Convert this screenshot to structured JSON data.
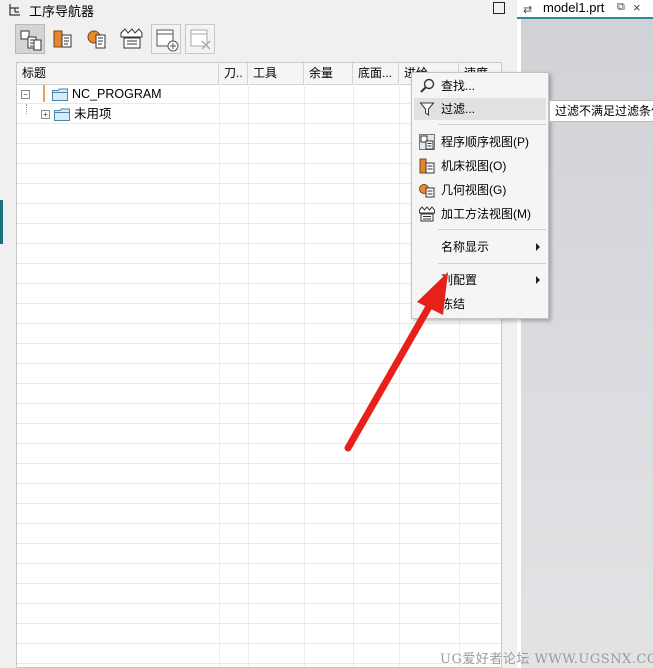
{
  "navigator": {
    "title": "工序导航器",
    "toolbar": [
      {
        "name": "program-order-view",
        "icon": "program-order-icon",
        "state": "active"
      },
      {
        "name": "machine-tool-view",
        "icon": "machine-tool-icon"
      },
      {
        "name": "geometry-view",
        "icon": "geometry-icon"
      },
      {
        "name": "machining-method-view",
        "icon": "machining-method-icon"
      },
      {
        "name": "add-column",
        "icon": "add-column-icon"
      },
      {
        "name": "remove-column",
        "icon": "remove-column-icon",
        "state": "disabled"
      }
    ],
    "columns": [
      "标题",
      "刀..",
      "工具",
      "余量",
      "底面...",
      "进给",
      "速度"
    ],
    "rows": [
      {
        "label": "NC_PROGRAM",
        "expander": "−",
        "icon": "folder-icon"
      },
      {
        "label": "未用项",
        "expander": "+",
        "icon": "folder-icon"
      }
    ]
  },
  "viewport": {
    "tab_label": "model1.prt",
    "tab_icon": "view-sync-icon",
    "pin_icon": "undock-icon",
    "close_icon": "close-icon",
    "accent_color": "#2d8aa0"
  },
  "context_menu": {
    "items": [
      {
        "label": "查找...",
        "icon": "search-icon"
      },
      {
        "label": "过滤...",
        "icon": "filter-icon",
        "state": "hovered"
      },
      {
        "label": "程序顺序视图(P)",
        "icon": "program-order-icon"
      },
      {
        "label": "机床视图(O)",
        "icon": "machine-tool-icon"
      },
      {
        "label": "几何视图(G)",
        "icon": "geometry-icon"
      },
      {
        "label": "加工方法视图(M)",
        "icon": "machining-method-icon"
      },
      {
        "label": "名称显示",
        "submenu": true
      },
      {
        "label": "列配置",
        "submenu": true
      },
      {
        "label": "冻结"
      }
    ]
  },
  "tooltip": {
    "text": "过滤不满足过滤条件"
  },
  "annotation": {
    "arrow_color": "#e8201a"
  },
  "watermark": {
    "text": "UG爱好者论坛 WWW.UGSNX.COM"
  }
}
